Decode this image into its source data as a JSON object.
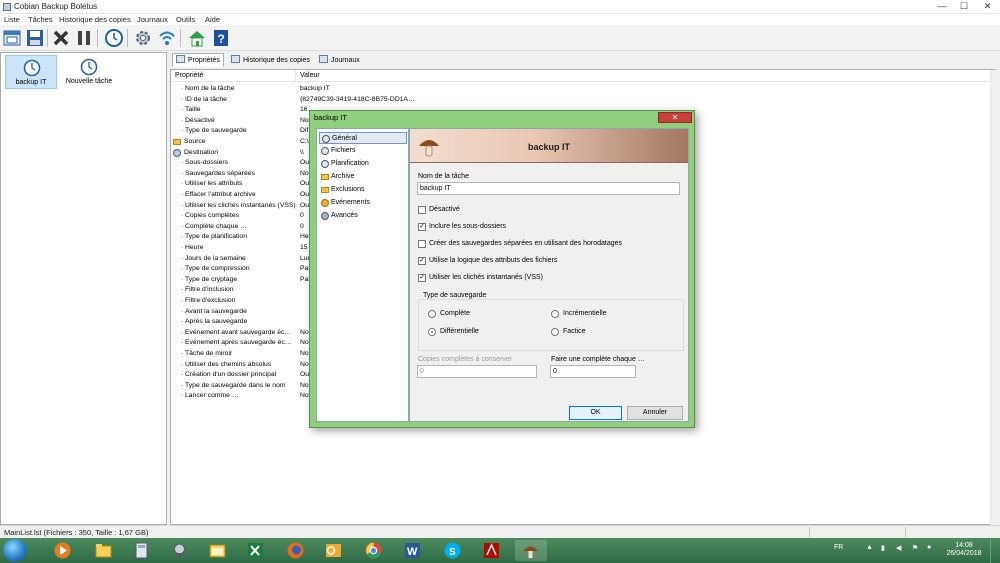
{
  "window": {
    "title": "Cobian Backup Boletus"
  },
  "menu": [
    "Liste",
    "Tâches",
    "Historique des copies",
    "Journaux",
    "Outils",
    "Aide"
  ],
  "toolbar": {
    "icons": [
      "new-list-icon",
      "save-icon",
      "delete-icon",
      "pause-icon",
      "clock-icon",
      "settings-icon",
      "wifi-icon",
      "home-icon",
      "help-icon"
    ]
  },
  "tasks": [
    {
      "label": "backup IT",
      "selected": true
    },
    {
      "label": "Nouvelle tâche",
      "selected": false
    }
  ],
  "tabs": [
    {
      "label": "Propriétés",
      "active": true
    },
    {
      "label": "Historique des copies",
      "active": false
    },
    {
      "label": "Journaux",
      "active": false
    }
  ],
  "properties": {
    "col_property": "Propriété",
    "col_value": "Valeur",
    "rows": [
      {
        "key": "Nom de la tâche",
        "value": "backup IT"
      },
      {
        "key": "ID de la tâche",
        "value": "{82749C39-3419-418C-8B75-DD1A…"
      },
      {
        "key": "Taille",
        "value": "16"
      },
      {
        "key": "Désactivé",
        "value": "No"
      },
      {
        "key": "Type de sauvegarde",
        "value": "Dif"
      },
      {
        "key": "Source",
        "value": "C:\\"
      },
      {
        "key": "Destination",
        "value": "\\\\"
      },
      {
        "key": "Sous-dossiers",
        "value": "Ou"
      },
      {
        "key": "Sauvegardes séparées",
        "value": "No"
      },
      {
        "key": "Utiliser les attributs",
        "value": "Ou"
      },
      {
        "key": "Effacer l'attribut archive",
        "value": "Ou"
      },
      {
        "key": "Utiliser les clichés instantanés (VSS)",
        "value": "Ou"
      },
      {
        "key": "Copies complètes",
        "value": "0"
      },
      {
        "key": "Complète chaque …",
        "value": "0"
      },
      {
        "key": "Type de planification",
        "value": "Heb"
      },
      {
        "key": "Heure",
        "value": "15"
      },
      {
        "key": "Jours de la semaine",
        "value": "Lun"
      },
      {
        "key": "Type de compression",
        "value": "Pas"
      },
      {
        "key": "Type de cryptage",
        "value": "Pas"
      },
      {
        "key": "Filtre d'inclusion",
        "value": ""
      },
      {
        "key": "Filtre d'exclusion",
        "value": ""
      },
      {
        "key": "Avant la sauvegarde",
        "value": ""
      },
      {
        "key": "Après la sauvegarde",
        "value": ""
      },
      {
        "key": "Evénement avant sauvegarde éc…",
        "value": "No"
      },
      {
        "key": "Evénement après sauvegarde éc…",
        "value": "No"
      },
      {
        "key": "Tâche de miroir",
        "value": "No"
      },
      {
        "key": "Utiliser des chemins absolus",
        "value": "No"
      },
      {
        "key": "Création d'un dossier principal",
        "value": "Ou"
      },
      {
        "key": "Type de sauvegarde dans le nom",
        "value": "No"
      },
      {
        "key": "Lancer comme …",
        "value": "No"
      }
    ]
  },
  "statusbar": {
    "text": "MainList.lst (Fichiers : 350, Taille : 1,67 GB)"
  },
  "dialog": {
    "title": "backup IT",
    "close_label": "✕",
    "nav": [
      {
        "label": "Général",
        "icon": "general-icon",
        "selected": true
      },
      {
        "label": "Fichiers",
        "icon": "files-icon",
        "selected": false
      },
      {
        "label": "Planification",
        "icon": "schedule-icon",
        "selected": false
      },
      {
        "label": "Archive",
        "icon": "archive-icon",
        "selected": false
      },
      {
        "label": "Exclusions",
        "icon": "exclusions-icon",
        "selected": false
      },
      {
        "label": "Evénements",
        "icon": "events-icon",
        "selected": false
      },
      {
        "label": "Avancés",
        "icon": "advanced-icon",
        "selected": false
      }
    ],
    "banner_title": "backup IT",
    "task_name_label": "Nom de la tâche",
    "task_name_value": "backup IT",
    "checkboxes": [
      {
        "label": "Désactivé",
        "checked": false
      },
      {
        "label": "Inclure les sous-dossiers",
        "checked": true
      },
      {
        "label": "Créer des sauvegardes séparées en utilisant des horodatages",
        "checked": false
      },
      {
        "label": "Utilise la logique des attributs des fichiers",
        "checked": true
      },
      {
        "label": "Utiliser les clichés instantanés (VSS)",
        "checked": true
      }
    ],
    "backup_type_label": "Type de sauvegarde",
    "backup_types": [
      {
        "label": "Complète",
        "selected": false
      },
      {
        "label": "Incrémentielle",
        "selected": false
      },
      {
        "label": "Différentielle",
        "selected": true
      },
      {
        "label": "Factice",
        "selected": false
      }
    ],
    "full_copies_label": "Copies complètes à conserver",
    "full_copies_value": "0",
    "full_every_label": "Faire une complète chaque …",
    "full_every_value": "0",
    "ok_label": "OK",
    "cancel_label": "Annuler"
  },
  "taskbar": {
    "apps": [
      "media-player-icon",
      "folder-icon",
      "calculator-icon",
      "tools-icon",
      "explorer-icon",
      "excel-icon",
      "firefox-icon",
      "outlook-icon",
      "chrome-icon",
      "word-icon",
      "skype-icon",
      "acrobat-icon",
      "cobian-icon"
    ],
    "lang": "FR",
    "time": "14:08",
    "date": "26/04/2018"
  },
  "colors": {
    "dialog_frame": "#8fcf7d",
    "taskbar": "#2f6b45",
    "selection": "#cce4f7"
  }
}
